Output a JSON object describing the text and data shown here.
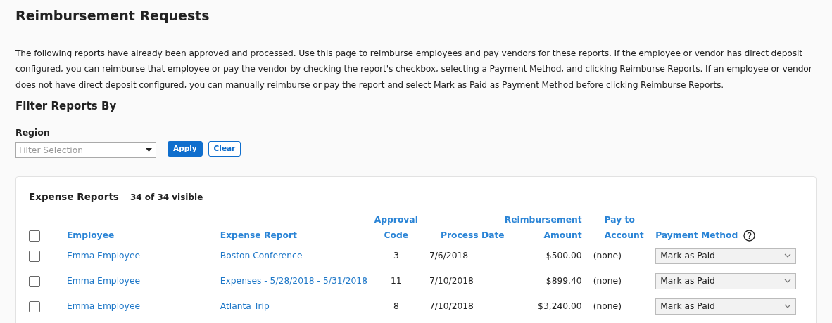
{
  "title": "Reimbursement Requests",
  "intro": "The following reports have already been approved and processed. Use this page to reimburse employees and pay vendors for these reports. If the employee or vendor has direct deposit configured, you can reimburse that employee or pay the vendor by checking the report's checkbox, selecting a Payment Method, and clicking Reimburse Reports. If an employee or vendor does not have direct deposit configured, you can manually reimburse or pay the report and select Mark as Paid as Payment Method before clicking Reimburse Reports.",
  "filter": {
    "heading": "Filter Reports By",
    "label": "Region",
    "placeholder": "Filter Selection",
    "apply": "Apply",
    "clear": "Clear"
  },
  "reports": {
    "title": "Expense Reports",
    "count": "34 of 34 visible",
    "select_all_checked": false,
    "columns": [
      [
        "Employee"
      ],
      [
        "Expense Report"
      ],
      [
        "Approval",
        "Code"
      ],
      [
        "Process Date"
      ],
      [
        "Reimbursement",
        "Amount"
      ],
      [
        "Pay to",
        "Account"
      ],
      [
        "Payment Method"
      ]
    ],
    "rows": [
      {
        "checked": false,
        "employee": "Emma Employee",
        "report": "Boston Conference",
        "code": "3",
        "date": "7/6/2018",
        "amount": "$500.00",
        "account": "(none)",
        "method": "Mark as Paid"
      },
      {
        "checked": false,
        "employee": "Emma Employee",
        "report": "Expenses - 5/28/2018 - 5/31/2018",
        "code": "11",
        "date": "7/10/2018",
        "amount": "$899.40",
        "account": "(none)",
        "method": "Mark as Paid"
      },
      {
        "checked": false,
        "employee": "Emma Employee",
        "report": "Atlanta Trip",
        "code": "8",
        "date": "7/10/2018",
        "amount": "$3,240.00",
        "account": "(none)",
        "method": "Mark as Paid"
      }
    ]
  }
}
